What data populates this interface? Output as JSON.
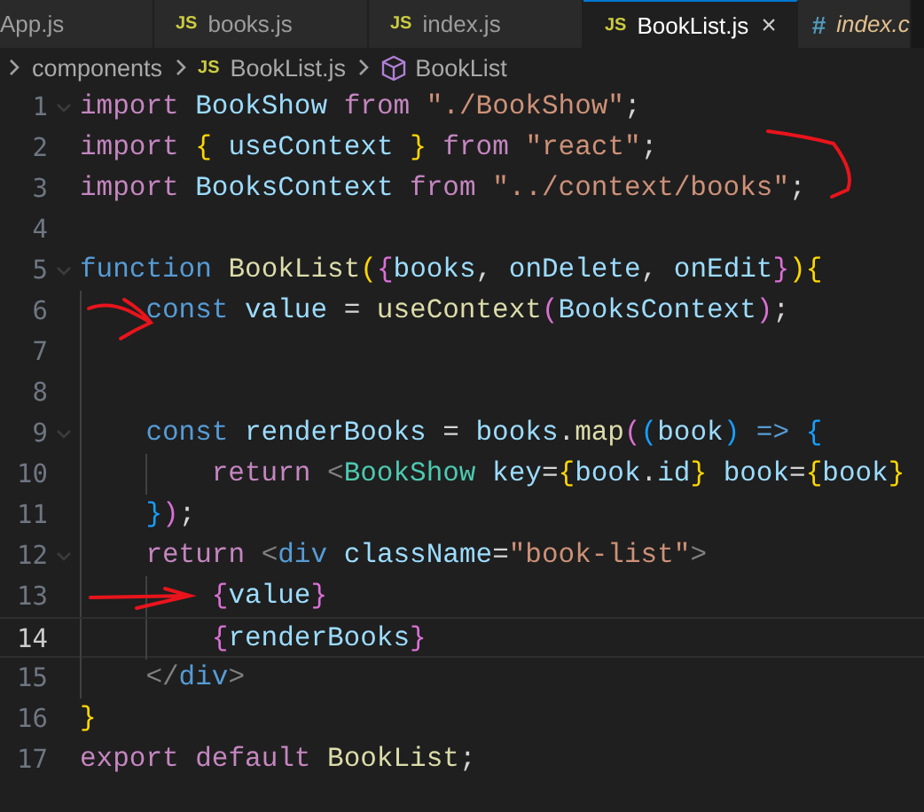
{
  "tabs": [
    {
      "label": "App.js",
      "selected": false,
      "preview": false,
      "modified": false
    },
    {
      "label": "books.js",
      "icon": "JS",
      "color": "#cbcb41",
      "selected": false,
      "preview": false,
      "modified": false
    },
    {
      "label": "index.js",
      "icon": "JS",
      "color": "#cbcb41",
      "selected": false,
      "preview": false,
      "modified": false
    },
    {
      "label": "BookList.js",
      "icon": "JS",
      "color": "#cbcb41",
      "selected": true,
      "preview": false,
      "modified": false,
      "close": "×"
    },
    {
      "label": "index.c",
      "icon": "#",
      "color": "#519aba",
      "selected": false,
      "preview": true,
      "modified": true
    }
  ],
  "breadcrumb": [
    {
      "kind": "folder",
      "label": "components"
    },
    {
      "kind": "file",
      "icon": "JS",
      "label": "BookList.js"
    },
    {
      "kind": "symbol",
      "label": "BookList"
    }
  ],
  "lines": [
    {
      "number": "1",
      "foldable": true,
      "current": false,
      "tokens": [
        {
          "kind": "kw",
          "text": "import "
        },
        {
          "kind": "var",
          "text": "BookShow "
        },
        {
          "kind": "kw",
          "text": "from "
        },
        {
          "kind": "str",
          "text": "\"./BookShow\""
        },
        {
          "kind": "p",
          "text": ";"
        }
      ]
    },
    {
      "number": "2",
      "foldable": false,
      "current": false,
      "tokens": [
        {
          "kind": "kw",
          "text": "import "
        },
        {
          "kind": "b1",
          "text": "{ "
        },
        {
          "kind": "var",
          "text": "useContext "
        },
        {
          "kind": "b1",
          "text": "} "
        },
        {
          "kind": "kw",
          "text": "from "
        },
        {
          "kind": "str",
          "text": "\"react\""
        },
        {
          "kind": "p",
          "text": ";"
        }
      ]
    },
    {
      "number": "3",
      "foldable": false,
      "current": false,
      "tokens": [
        {
          "kind": "kw",
          "text": "import "
        },
        {
          "kind": "var",
          "text": "BooksContext "
        },
        {
          "kind": "kw",
          "text": "from "
        },
        {
          "kind": "str",
          "text": "\"../context/books\""
        },
        {
          "kind": "p",
          "text": ";"
        }
      ]
    },
    {
      "number": "4",
      "foldable": false,
      "current": false
    },
    {
      "number": "5",
      "foldable": true,
      "current": false,
      "tokens": [
        {
          "kind": "decl",
          "text": "function "
        },
        {
          "kind": "fn",
          "text": "BookList"
        },
        {
          "kind": "b1",
          "text": "("
        },
        {
          "kind": "b2",
          "text": "{"
        },
        {
          "kind": "var",
          "text": "books"
        },
        {
          "kind": "p",
          "text": ", "
        },
        {
          "kind": "var",
          "text": "onDelete"
        },
        {
          "kind": "p",
          "text": ", "
        },
        {
          "kind": "var",
          "text": "onEdit"
        },
        {
          "kind": "b2",
          "text": "}"
        },
        {
          "kind": "b1",
          "text": ")"
        },
        {
          "kind": "b1",
          "text": "{"
        }
      ],
      "children": [
        {
          "number": "6",
          "foldable": false,
          "current": false,
          "tokens": [
            {
              "kind": "decl",
              "text": "const "
            },
            {
              "kind": "var",
              "text": "value "
            },
            {
              "kind": "p",
              "text": "= "
            },
            {
              "kind": "fn",
              "text": "useContext"
            },
            {
              "kind": "b2",
              "text": "("
            },
            {
              "kind": "var",
              "text": "BooksContext"
            },
            {
              "kind": "b2",
              "text": ")"
            },
            {
              "kind": "p",
              "text": ";"
            }
          ]
        },
        {
          "number": "7",
          "foldable": false,
          "current": false
        },
        {
          "number": "8",
          "foldable": false,
          "current": false
        },
        {
          "number": "9",
          "foldable": true,
          "current": false,
          "tokens": [
            {
              "kind": "decl",
              "text": "const "
            },
            {
              "kind": "var",
              "text": "renderBooks "
            },
            {
              "kind": "p",
              "text": "= "
            },
            {
              "kind": "var",
              "text": "books"
            },
            {
              "kind": "p",
              "text": "."
            },
            {
              "kind": "fn",
              "text": "map"
            },
            {
              "kind": "b2",
              "text": "("
            },
            {
              "kind": "b3",
              "text": "("
            },
            {
              "kind": "var",
              "text": "book"
            },
            {
              "kind": "b3",
              "text": ") "
            },
            {
              "kind": "decl",
              "text": "=> "
            },
            {
              "kind": "b3",
              "text": "{"
            }
          ],
          "children": [
            {
              "number": "10",
              "foldable": false,
              "current": false,
              "tokens": [
                {
                  "kind": "kw",
                  "text": "return "
                },
                {
                  "kind": "tagp",
                  "text": "<"
                },
                {
                  "kind": "comp",
                  "text": "BookShow "
                },
                {
                  "kind": "var",
                  "text": "key"
                },
                {
                  "kind": "p",
                  "text": "="
                },
                {
                  "kind": "b1",
                  "text": "{"
                },
                {
                  "kind": "var",
                  "text": "book"
                },
                {
                  "kind": "p",
                  "text": "."
                },
                {
                  "kind": "var",
                  "text": "id"
                },
                {
                  "kind": "b1",
                  "text": "} "
                },
                {
                  "kind": "var",
                  "text": "book"
                },
                {
                  "kind": "p",
                  "text": "="
                },
                {
                  "kind": "b1",
                  "text": "{"
                },
                {
                  "kind": "var",
                  "text": "book"
                },
                {
                  "kind": "b1",
                  "text": "}"
                }
              ]
            }
          ]
        },
        {
          "number": "11",
          "foldable": false,
          "current": false,
          "tokens": [
            {
              "kind": "b3",
              "text": "}"
            },
            {
              "kind": "b2",
              "text": ")"
            },
            {
              "kind": "p",
              "text": ";"
            }
          ]
        },
        {
          "number": "12",
          "foldable": true,
          "current": false,
          "tokens": [
            {
              "kind": "kw",
              "text": "return "
            },
            {
              "kind": "tagp",
              "text": "<"
            },
            {
              "kind": "decl",
              "text": "div "
            },
            {
              "kind": "var",
              "text": "className"
            },
            {
              "kind": "p",
              "text": "="
            },
            {
              "kind": "str",
              "text": "\"book-list\""
            },
            {
              "kind": "tagp",
              "text": ">"
            }
          ],
          "children": [
            {
              "number": "13",
              "foldable": false,
              "current": false,
              "tokens": [
                {
                  "kind": "b2",
                  "text": "{"
                },
                {
                  "kind": "var",
                  "text": "value"
                },
                {
                  "kind": "b2",
                  "text": "}"
                }
              ]
            },
            {
              "number": "14",
              "foldable": false,
              "current": true,
              "tokens": [
                {
                  "kind": "b2",
                  "text": "{"
                },
                {
                  "kind": "var",
                  "text": "renderBooks"
                },
                {
                  "kind": "b2",
                  "text": "}"
                }
              ]
            }
          ]
        },
        {
          "number": "15",
          "foldable": false,
          "current": false,
          "tokens": [
            {
              "kind": "tagp",
              "text": "</"
            },
            {
              "kind": "decl",
              "text": "div"
            },
            {
              "kind": "tagp",
              "text": ">"
            }
          ]
        }
      ]
    },
    {
      "number": "16",
      "foldable": false,
      "current": false,
      "tokens": [
        {
          "kind": "b1",
          "text": "}"
        }
      ]
    },
    {
      "number": "17",
      "foldable": false,
      "current": false,
      "tokens": [
        {
          "kind": "kw",
          "text": "export default "
        },
        {
          "kind": "fn",
          "text": "BookList"
        },
        {
          "kind": "p",
          "text": ";"
        }
      ]
    }
  ]
}
